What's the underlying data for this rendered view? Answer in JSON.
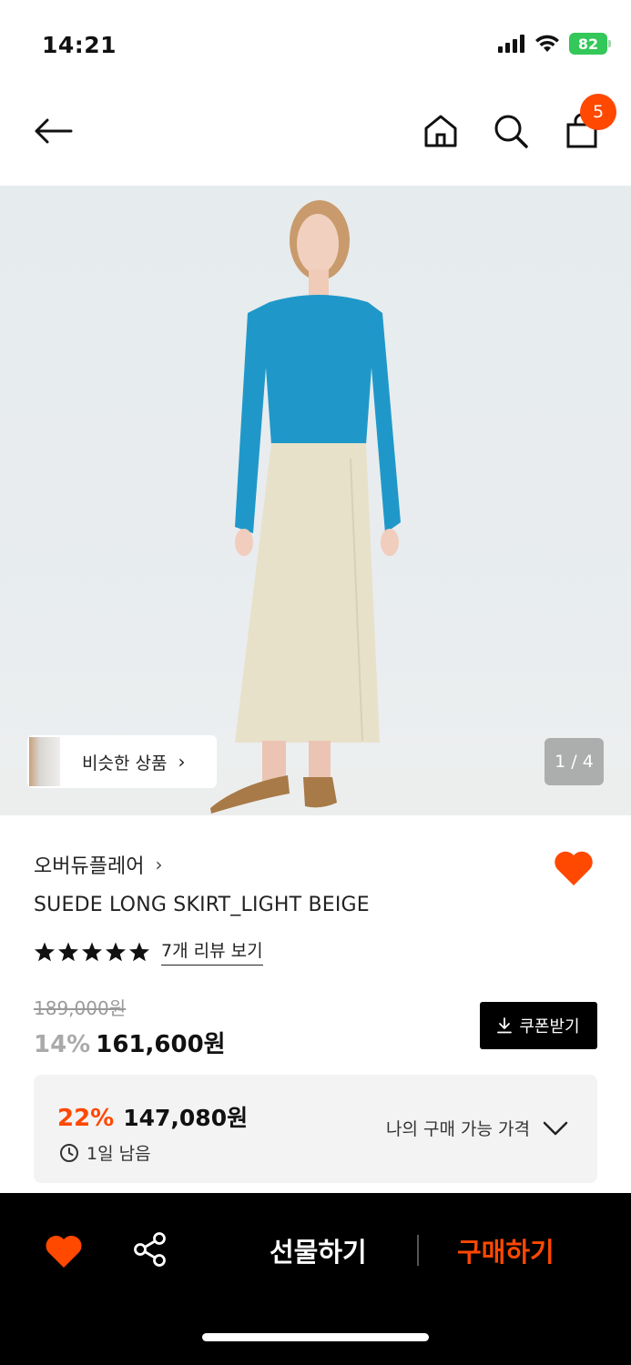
{
  "status_bar": {
    "time": "14:21",
    "battery": "82"
  },
  "nav": {
    "cart_count": "5"
  },
  "hero": {
    "similar_label": "비슷한 상품",
    "page_counter": "1 / 4"
  },
  "product": {
    "brand": "오버듀플레어",
    "name": "SUEDE LONG SKIRT_LIGHT BEIGE",
    "rating_stars": 5,
    "review_link": "7개 리뷰 보기",
    "original_price": "189,000원",
    "discount": "14%",
    "price": "161,600원",
    "coupon_label": "쿠폰받기"
  },
  "best_offer": {
    "discount": "22%",
    "price": "147,080원",
    "time_left": "1일 남음",
    "my_price_label": "나의 구매 가능 가격"
  },
  "bottom_bar": {
    "gift_label": "선물하기",
    "buy_label": "구매하기"
  },
  "colors": {
    "accent": "#ff4800",
    "black": "#000000",
    "box_bg": "#f3f3f3"
  },
  "icons": [
    "back-arrow-icon",
    "home-icon",
    "search-icon",
    "shopping-bag-icon",
    "heart-icon",
    "share-icon",
    "download-icon",
    "clock-icon",
    "chevron-down-icon",
    "chevron-right-icon"
  ]
}
